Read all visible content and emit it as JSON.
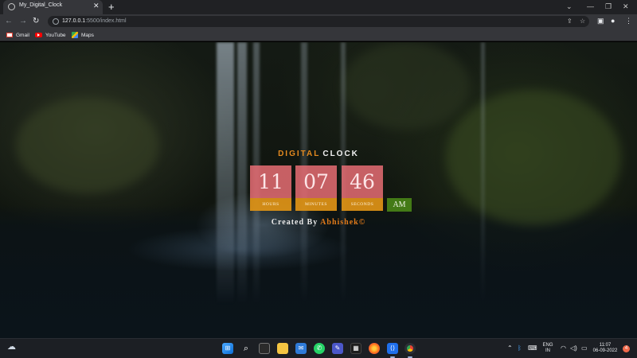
{
  "browser": {
    "tab_title": "My_Digital_Clock",
    "new_tab_label": "+",
    "url_host": "127.0.0.1",
    "url_path": ":5500/index.html",
    "bookmarks": [
      {
        "label": "Gmail",
        "icon": "gmail-icon"
      },
      {
        "label": "YouTube",
        "icon": "youtube-icon"
      },
      {
        "label": "Maps",
        "icon": "maps-icon"
      }
    ]
  },
  "clock": {
    "heading_part1": "DIGITAL",
    "heading_part2": "CLOCK",
    "hours_value": "11",
    "hours_label": "HOURS",
    "minutes_value": "07",
    "minutes_label": "MINUTES",
    "seconds_value": "46",
    "seconds_label": "SECONDS",
    "ampm": "AM",
    "credit_prefix": "Created By",
    "credit_name": "Abhishek©"
  },
  "taskbar": {
    "language_line1": "ENG",
    "language_line2": "IN",
    "time": "11:07",
    "date": "06-09-2022",
    "notification_count": "4"
  },
  "colors": {
    "heading_accent": "#e58a1f",
    "digit_box": "#ef7078",
    "label_bar": "#e09416",
    "ampm_box": "#4c8c18",
    "credit_name": "#e07a1a"
  }
}
